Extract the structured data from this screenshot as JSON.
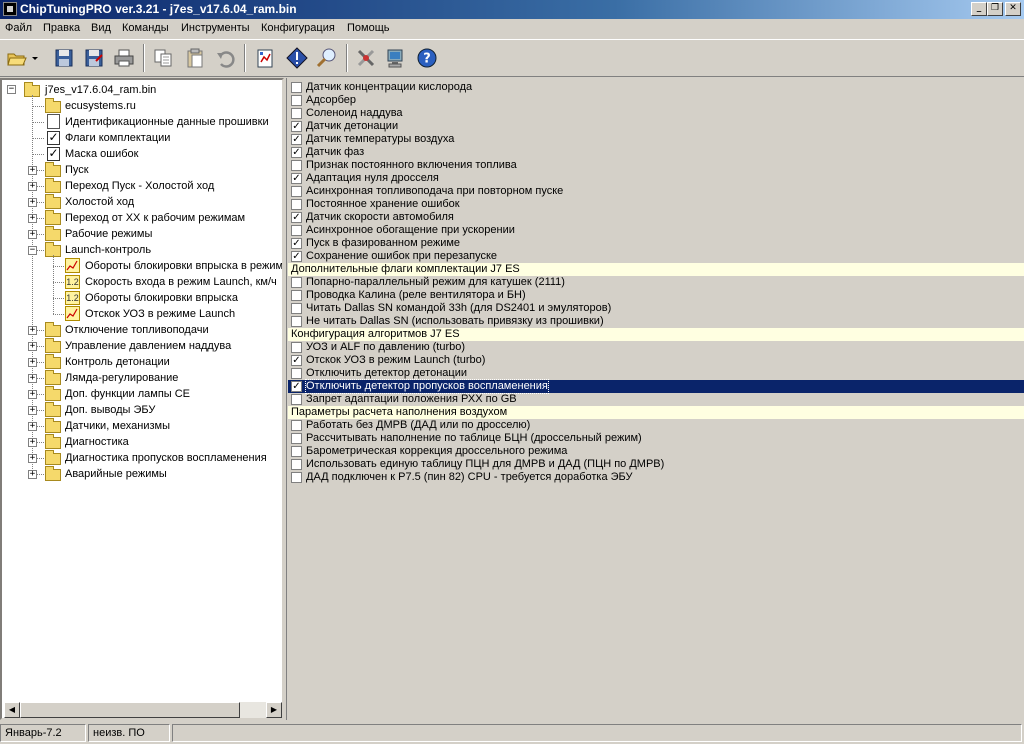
{
  "window": {
    "title": "ChipTuningPRO ver.3.21 - j7es_v17.6.04_ram.bin"
  },
  "menu": [
    "Файл",
    "Правка",
    "Вид",
    "Команды",
    "Инструменты",
    "Конфигурация",
    "Помощь"
  ],
  "toolbar": {
    "buttons": [
      "open-icon",
      "save-icon",
      "save-as-icon",
      "print-icon",
      "copy-icon",
      "paste-icon",
      "undo-icon",
      "compare-icon",
      "info-icon",
      "search-icon",
      "tools-icon",
      "network-icon",
      "help-icon"
    ]
  },
  "tree": {
    "root": "j7es_v17.6.04_ram.bin",
    "items": [
      {
        "label": "ecusystems.ru",
        "icon": "folder"
      },
      {
        "label": "Идентификационные данные прошивки",
        "icon": "document"
      },
      {
        "label": "Флаги комплектации",
        "icon": "checkbox"
      },
      {
        "label": "Маска ошибок",
        "icon": "checkbox"
      },
      {
        "label": "Пуск",
        "icon": "folder"
      },
      {
        "label": "Переход Пуск - Холостой ход",
        "icon": "folder"
      },
      {
        "label": "Холостой ход",
        "icon": "folder"
      },
      {
        "label": "Переход от ХХ к рабочим режимам",
        "icon": "folder"
      },
      {
        "label": "Рабочие режимы",
        "icon": "folder"
      },
      {
        "label": "Launch-контроль",
        "icon": "folder-open"
      },
      {
        "label": "Обороты блокировки впрыска в режим",
        "icon": "chart"
      },
      {
        "label": "Скорость входа в режим Launch, км/ч",
        "icon": "number"
      },
      {
        "label": "Обороты блокировки впрыска",
        "icon": "number"
      },
      {
        "label": "Отскок УОЗ в режиме Launch",
        "icon": "chart"
      },
      {
        "label": "Отключение топливоподачи",
        "icon": "folder"
      },
      {
        "label": "Управление давлением наддува",
        "icon": "folder"
      },
      {
        "label": "Контроль детонации",
        "icon": "folder"
      },
      {
        "label": "Лямда-регулирование",
        "icon": "folder"
      },
      {
        "label": "Доп. функции лампы CE",
        "icon": "folder"
      },
      {
        "label": "Доп. выводы ЭБУ",
        "icon": "folder"
      },
      {
        "label": "Датчики, механизмы",
        "icon": "folder"
      },
      {
        "label": "Диагностика",
        "icon": "folder"
      },
      {
        "label": "Диагностика пропусков воспламенения",
        "icon": "folder"
      },
      {
        "label": "Аварийные режимы",
        "icon": "folder"
      }
    ]
  },
  "options": [
    {
      "type": "item",
      "label": "Датчик концентрации кислорода",
      "checked": false
    },
    {
      "type": "item",
      "label": "Адсорбер",
      "checked": false
    },
    {
      "type": "item",
      "label": "Соленоид наддува",
      "checked": false
    },
    {
      "type": "item",
      "label": "Датчик детонации",
      "checked": true
    },
    {
      "type": "item",
      "label": "Датчик температуры воздуха",
      "checked": true
    },
    {
      "type": "item",
      "label": "Датчик фаз",
      "checked": true
    },
    {
      "type": "item",
      "label": "Признак постоянного включения топлива",
      "checked": false
    },
    {
      "type": "item",
      "label": "Адаптация нуля дросселя",
      "checked": true
    },
    {
      "type": "item",
      "label": "Асинхронная топливоподача при повторном пуске",
      "checked": false
    },
    {
      "type": "item",
      "label": "Постоянное хранение ошибок",
      "checked": false
    },
    {
      "type": "item",
      "label": "Датчик скорости автомобиля",
      "checked": true
    },
    {
      "type": "item",
      "label": "Асинхронное обогащение при ускорении",
      "checked": false
    },
    {
      "type": "item",
      "label": "Пуск в фазированном режиме",
      "checked": true
    },
    {
      "type": "item",
      "label": "Сохранение ошибок при перезапуске",
      "checked": true
    },
    {
      "type": "header",
      "label": "Дополнительные флаги комплектации J7 ES"
    },
    {
      "type": "item",
      "label": "Попарно-параллельный режим для катушек (2111)",
      "checked": false
    },
    {
      "type": "item",
      "label": "Проводка Калина (реле вентилятора и БН)",
      "checked": false
    },
    {
      "type": "item",
      "label": "Читать Dallas SN командой 33h (для DS2401 и эмуляторов)",
      "checked": false
    },
    {
      "type": "item",
      "label": "Не читать Dallas SN (использовать привязку из прошивки)",
      "checked": false
    },
    {
      "type": "header",
      "label": "Конфигурация алгоритмов J7 ES"
    },
    {
      "type": "item",
      "label": "УОЗ и ALF по давлению (turbo)",
      "checked": false
    },
    {
      "type": "item",
      "label": "Отскок УОЗ в режим Launch (turbo)",
      "checked": true
    },
    {
      "type": "item",
      "label": "Отключить детектор детонации",
      "checked": false
    },
    {
      "type": "item",
      "label": "Отключить детектор пропусков воспламенения",
      "checked": true,
      "selected": true
    },
    {
      "type": "item",
      "label": "Запрет адаптации положения РХХ по GB",
      "checked": false
    },
    {
      "type": "header",
      "label": "Параметры расчета наполнения воздухом"
    },
    {
      "type": "item",
      "label": "Работать без ДМРВ (ДАД или по дросселю)",
      "checked": false
    },
    {
      "type": "item",
      "label": "Рассчитывать наполнение по таблице БЦН (дроссельный режим)",
      "checked": false
    },
    {
      "type": "item",
      "label": "Барометрическая коррекция дроссельного режима",
      "checked": false
    },
    {
      "type": "item",
      "label": "Использовать единую таблицу ПЦН для ДМРВ и ДАД (ПЦН по ДМРВ)",
      "checked": false
    },
    {
      "type": "item",
      "label": "ДАД подключен к P7.5 (пин 82) CPU - требуется доработка ЭБУ",
      "checked": false
    }
  ],
  "statusbar": {
    "firmware": "Январь-7.2",
    "software": "неизв. ПО",
    "extra": ""
  },
  "colors": {
    "titlebar_start": "#0a246a",
    "selection": "#0a246a",
    "section_header_bg": "#ffffe1",
    "window_bg": "#d4d0c8"
  }
}
